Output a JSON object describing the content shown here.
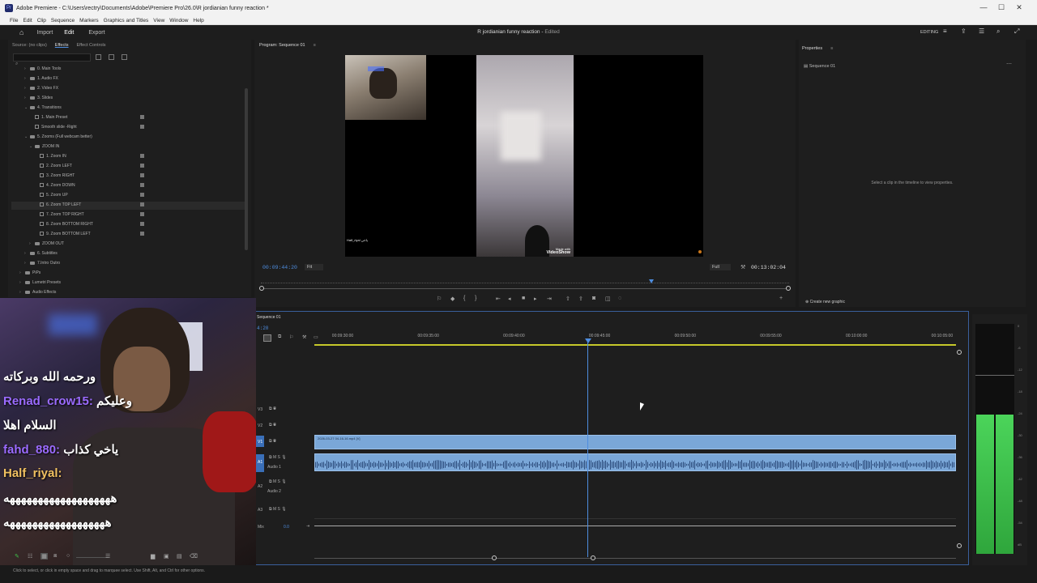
{
  "window": {
    "title": "Adobe Premiere - C:\\Users\\rectry\\Documents\\Adobe\\Premiere Pro\\26.0\\R jordianian funny reaction *",
    "minimize": "—",
    "maximize": "☐",
    "close": "✕"
  },
  "menu": [
    "File",
    "Edit",
    "Clip",
    "Sequence",
    "Markers",
    "Graphics and Titles",
    "View",
    "Window",
    "Help"
  ],
  "appbar": {
    "tabs": [
      "Import",
      "Edit",
      "Export"
    ],
    "active_tab": "Edit",
    "project_title": "R jordianian funny reaction",
    "project_status": "Edited",
    "workspace": "EDITING"
  },
  "effects_panel": {
    "tabs": [
      "Source: (no clips)",
      "Effects",
      "Effect Controls"
    ],
    "tree": [
      {
        "label": "0. Main Tools",
        "type": "folder",
        "arrow": "›"
      },
      {
        "label": "1. Audio FX",
        "type": "folder",
        "arrow": "›"
      },
      {
        "label": "2. Video FX",
        "type": "folder",
        "arrow": "›"
      },
      {
        "label": "3. Slides",
        "type": "folder",
        "arrow": "›"
      },
      {
        "label": "4. Transitions",
        "type": "folder",
        "arrow": "⌄"
      },
      {
        "label": "1. Main Preset",
        "type": "fx"
      },
      {
        "label": "Smooth slide -Right",
        "type": "fx"
      },
      {
        "label": "5. Zooms (Full webcam better)",
        "type": "folder",
        "arrow": "⌄"
      },
      {
        "label": "ZOOM IN",
        "type": "folder",
        "arrow": "⌄"
      },
      {
        "label": "1. Zoom IN",
        "type": "fx"
      },
      {
        "label": "2. Zoom LEFT",
        "type": "fx"
      },
      {
        "label": "3. Zoom RIGHT",
        "type": "fx"
      },
      {
        "label": "4. Zoom DOWN",
        "type": "fx"
      },
      {
        "label": "5. Zoom UP",
        "type": "fx"
      },
      {
        "label": "6. Zoom TOP LEFT",
        "type": "fx"
      },
      {
        "label": "7. Zoom TOP RIGHT",
        "type": "fx"
      },
      {
        "label": "8. Zoom BOTTOM RIGHT",
        "type": "fx"
      },
      {
        "label": "9. Zoom BOTTOM LEFT",
        "type": "fx"
      },
      {
        "label": "ZOOM OUT",
        "type": "folder",
        "arrow": "›"
      },
      {
        "label": "6. Subtitles",
        "type": "folder",
        "arrow": "›"
      },
      {
        "label": "7.Intro Outro",
        "type": "folder",
        "arrow": "›"
      },
      {
        "label": "PiPs",
        "type": "folder",
        "arrow": "›"
      },
      {
        "label": "Lumetri Presets",
        "type": "folder",
        "arrow": "›"
      },
      {
        "label": "Audio Effects",
        "type": "folder",
        "arrow": "›"
      }
    ]
  },
  "program_monitor": {
    "title": "Program: Sequence 01",
    "timecode": "00:09:44:20",
    "fit": "Fit",
    "quality": "Full",
    "duration": "00:13:02:04",
    "overlay_text": "Half_riyal ياخي",
    "watermark_line1": "Made with",
    "watermark_line2": "VideoShow",
    "playhead_position": 0.74
  },
  "properties_panel": {
    "title": "Properties",
    "sequence": "Sequence 01",
    "hint": "Select a clip in the timeline to view properties.",
    "create_graphic": "Create new graphic"
  },
  "timeline": {
    "sequence_tab": "Sequence 01",
    "timecode": "4:20",
    "ruler": [
      "00:09:30:00",
      "00:09:35:00",
      "00:09:40:00",
      "00:09:45:00",
      "00:09:50:00",
      "00:09:55:00",
      "00:10:00:00",
      "00:10:05:00"
    ],
    "tracks": {
      "v3": "V3",
      "v2": "V2",
      "v1": "V1",
      "a1": "A1",
      "a1_name": "Audio 1",
      "a2": "A2",
      "a2_name": "Audio 2",
      "a3": "A3",
      "mix": "Mix",
      "mix_value": "0.0"
    },
    "video_clip": "2026-03-27 04-16-16.mp4 [V]"
  },
  "meter_scale": [
    "0",
    "-6",
    "-12",
    "-18",
    "-24",
    "-30",
    "-36",
    "-42",
    "-48",
    "-54",
    "dB"
  ],
  "chat_overlay": [
    {
      "user": "",
      "message": "ورحمه الله وبركاته",
      "color": "#ffffff"
    },
    {
      "user": "Renad_crow15:",
      "message": "وعليكم",
      "color": "#9b6bff"
    },
    {
      "user": "",
      "message": "السلام اهلا",
      "color": "#ffffff"
    },
    {
      "user": "fahd_880:",
      "message": "ياخي كذاب",
      "color": "#9b6bff"
    },
    {
      "user": "Half_riyal:",
      "message": "",
      "color": "#f0c060"
    },
    {
      "user": "",
      "message": "هههههههههههههههههههه",
      "color": "#ffffff"
    },
    {
      "user": "",
      "message": "ههههههههههههههههههه",
      "color": "#ffffff"
    }
  ],
  "statusbar": "Click to select, or click in empty space and drag to marquee select. Use Shift, Alt, and Ctrl for other options.",
  "colors": {
    "accent_blue": "#4e8ddf",
    "clip_blue": "#7aa7d8",
    "meter_green": "#3fc04a",
    "chat_purple": "#9b6bff"
  }
}
